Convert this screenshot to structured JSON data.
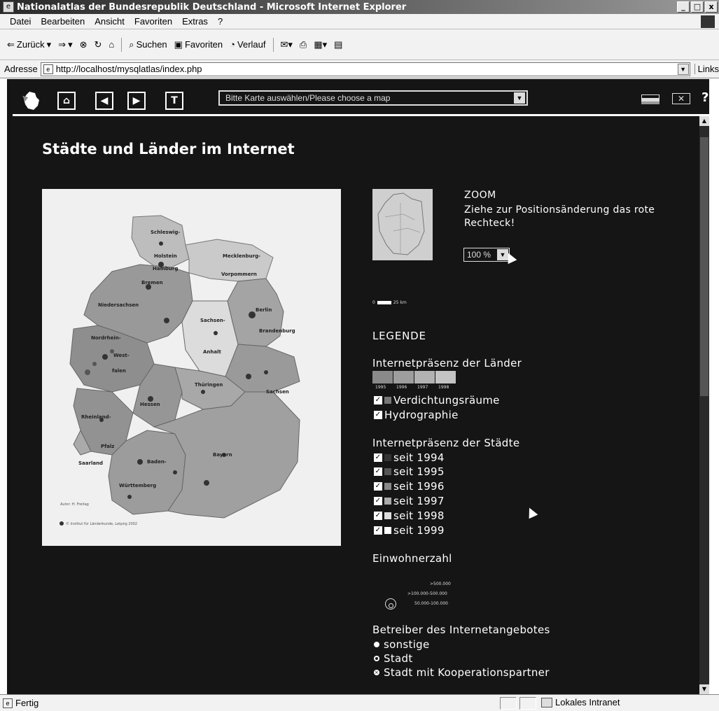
{
  "window": {
    "title": "Nationalatlas der Bundesrepublik Deutschland - Microsoft Internet Explorer",
    "min": "_",
    "max": "□",
    "close": "x"
  },
  "menu": [
    "Datei",
    "Bearbeiten",
    "Ansicht",
    "Favoriten",
    "Extras",
    "?"
  ],
  "toolbar": {
    "back": "Zurück",
    "search": "Suchen",
    "favorites": "Favoriten",
    "history": "Verlauf"
  },
  "address": {
    "label": "Adresse",
    "url": "http://localhost/mysqlatlas/index.php",
    "links": "Links"
  },
  "app": {
    "map_select": "Bitte Karte auswählen/Please choose a map",
    "help": "?",
    "page_title": "Städte und Länder im Internet",
    "zoom_title": "ZOOM",
    "zoom_text": "Ziehe zur Positionsänderung das rote Rechteck!",
    "zoom_value": "100 %",
    "scale_start": "0",
    "scale_end": "25 km"
  },
  "map": {
    "labels": [
      "Schleswig-",
      "Holstein",
      "Hamburg",
      "Mecklenburg-",
      "Vorpommern",
      "Bremen",
      "Niedersachsen",
      "Berlin",
      "Sachsen-",
      "Anhalt",
      "Brandenburg",
      "Nordrhein-",
      "West-",
      "falen",
      "Sachsen",
      "Hessen",
      "Thüringen",
      "Rheinland-",
      "Pfalz",
      "Saarland",
      "Baden-",
      "Württemberg",
      "Bayern"
    ],
    "credit": "Autor: H. Freitag",
    "copyright": "© Institut für Länderkunde, Leipzig 2002"
  },
  "legend": {
    "title": "LEGENDE",
    "laender_title": "Internetpräsenz der Länder",
    "ramp_colors": [
      "#8a8a8a",
      "#9e9e9e",
      "#b2b2b2",
      "#c4c4c4"
    ],
    "ramp_years": [
      "1995",
      "1996",
      "1997",
      "1998"
    ],
    "layers": [
      {
        "label": "Verdichtungsräume",
        "checked": true,
        "swatch": "#777777"
      },
      {
        "label": "Hydrographie",
        "checked": true,
        "swatch": ""
      }
    ],
    "staedte_title": "Internetpräsenz der Städte",
    "years": [
      {
        "label": "seit 1994",
        "checked": true,
        "swatch": "#333333"
      },
      {
        "label": "seit 1995",
        "checked": true,
        "swatch": "#555555"
      },
      {
        "label": "seit 1996",
        "checked": true,
        "swatch": "#888888"
      },
      {
        "label": "seit 1997",
        "checked": true,
        "swatch": "#aaaaaa"
      },
      {
        "label": "seit 1998",
        "checked": true,
        "swatch": "#dddddd"
      },
      {
        "label": "seit 1999",
        "checked": true,
        "swatch": "#ffffff"
      }
    ],
    "einwohner_title": "Einwohnerzahl",
    "einwohner_classes": [
      ">500.000",
      ">100.000-500.000",
      "50.000-100.000"
    ],
    "betreiber_title": "Betreiber des Internetangebotes",
    "betreiber": [
      "sonstige",
      "Stadt",
      "Stadt mit Kooperationspartner"
    ]
  },
  "status": {
    "text": "Fertig",
    "zone": "Lokales Intranet"
  }
}
